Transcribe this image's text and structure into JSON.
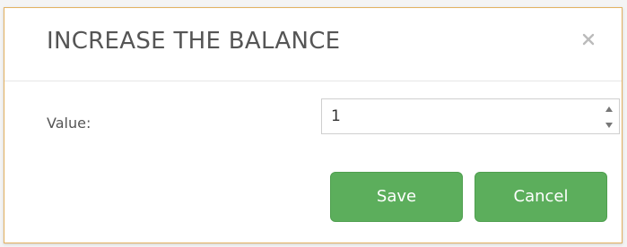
{
  "dialog": {
    "title": "INCREASE THE BALANCE",
    "close_icon": "close-icon"
  },
  "form": {
    "value_label": "Value:",
    "value": "1",
    "spinner_icons": [
      "chevron-up-icon",
      "chevron-down-icon"
    ]
  },
  "buttons": {
    "save_label": "Save",
    "cancel_label": "Cancel"
  },
  "colors": {
    "button_green": "#5cae5c",
    "dialog_border": "#e3b160",
    "title_text": "#555555"
  }
}
